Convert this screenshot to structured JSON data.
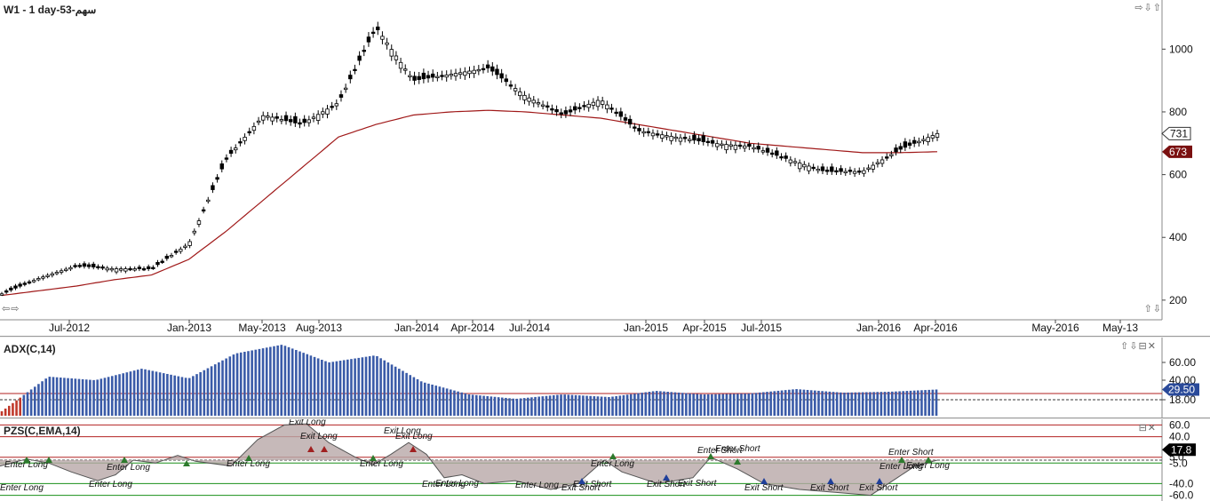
{
  "main": {
    "title": "W1 - 1 day-سهم-53",
    "controls_top": "⇨⇩⇧",
    "controls_left": "⇦⇨",
    "controls_right": "⇧⇩",
    "y_ticks": [
      "1000",
      "800",
      "600",
      "400",
      "200"
    ],
    "x_ticks": [
      "Jul-2012",
      "Jan-2013",
      "May-2013",
      "Aug-2013",
      "Jan-2014",
      "Apr-2014",
      "Jul-2014",
      "Jan-2015",
      "Apr-2015",
      "Jul-2015",
      "Jan-2016",
      "Apr-2016",
      "May-2016",
      "May-13"
    ],
    "last_price_label": "731",
    "ma_label": "673",
    "colors": {
      "ma_line": "#a01919",
      "candle": "#000000",
      "ma_badge": "#7a1010"
    }
  },
  "adx": {
    "title": "ADX(C,14)",
    "controls": "⇧⇩⊟✕",
    "y_ticks": [
      "60.00",
      "40.00",
      "18.00"
    ],
    "value_label": "29.50",
    "colors": {
      "bars": "#3a5ba8",
      "value_badge": "#2a4a9a",
      "threshold_line": "#b22222"
    }
  },
  "pzs": {
    "title": "PZS(C,EMA,14)",
    "controls": "⊟✕",
    "y_ticks": [
      "60.0",
      "40.0",
      "5.0",
      "-5.0",
      "-40.0",
      "-60.0"
    ],
    "value_label": "17.8",
    "signals": [
      "Enter Long",
      "Exit Long",
      "Enter Short",
      "Exit Short"
    ],
    "colors": {
      "upper_band": "#b22222",
      "lower_band": "#1a8f1a",
      "fill_area": "#b8a8a8"
    }
  },
  "chart_data": [
    {
      "type": "candlestick",
      "title": "W1 - 1 day-سهم-53",
      "x": [
        "2012-04",
        "2012-07",
        "2012-10",
        "2013-01",
        "2013-03",
        "2013-05",
        "2013-06",
        "2013-08",
        "2013-10",
        "2013-12",
        "2014-01",
        "2014-02",
        "2014-04",
        "2014-05",
        "2014-07",
        "2014-09",
        "2014-11",
        "2015-01",
        "2015-03",
        "2015-05",
        "2015-07",
        "2015-09",
        "2015-11",
        "2016-01",
        "2016-02",
        "2016-04"
      ],
      "close": [
        220,
        270,
        310,
        300,
        300,
        380,
        650,
        790,
        760,
        830,
        1070,
        900,
        920,
        940,
        850,
        790,
        840,
        740,
        720,
        700,
        690,
        650,
        610,
        610,
        680,
        731
      ],
      "ma": [
        215,
        230,
        245,
        265,
        280,
        330,
        420,
        520,
        620,
        720,
        760,
        790,
        800,
        805,
        800,
        790,
        780,
        760,
        740,
        720,
        700,
        690,
        680,
        670,
        670,
        673
      ],
      "ylim": [
        160,
        1100
      ]
    },
    {
      "type": "bar",
      "title": "ADX(C,14)",
      "values": [
        5,
        44,
        40,
        53,
        42,
        70,
        80,
        60,
        68,
        38,
        24,
        19,
        24,
        21,
        28,
        24,
        25,
        30,
        26,
        27,
        29.5
      ],
      "ylim": [
        0,
        80
      ],
      "threshold": 25
    },
    {
      "type": "line",
      "title": "PZS(C,EMA,14)",
      "levels": [
        60,
        40,
        17.8,
        5,
        -5,
        -40,
        -60
      ],
      "value": 17.8,
      "ylim": [
        -70,
        70
      ]
    }
  ]
}
